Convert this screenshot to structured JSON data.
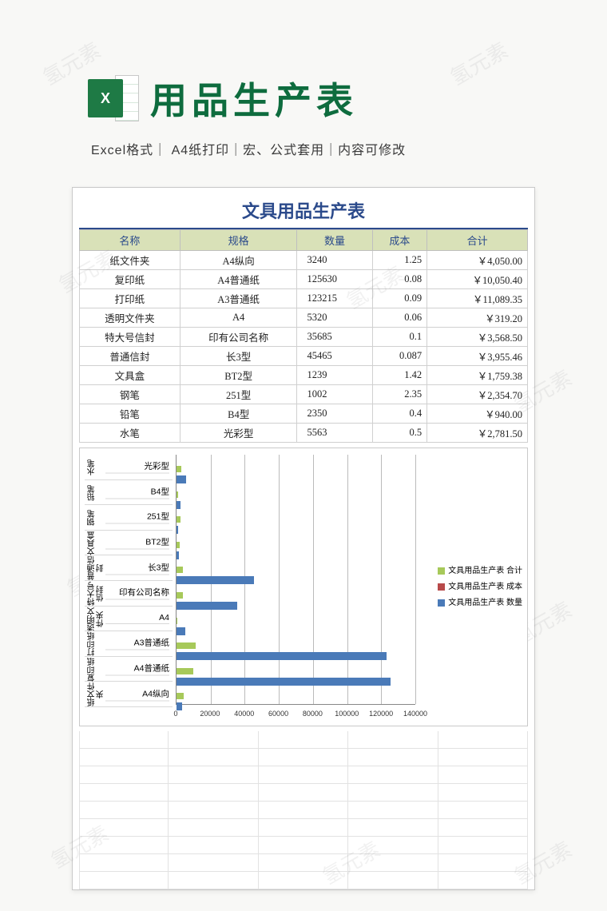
{
  "header": {
    "icon_label": "X",
    "title": "用品生产表",
    "subtitle": "Excel格式｜ A4纸打印｜宏、公式套用｜内容可修改"
  },
  "doc_title": "文具用品生产表",
  "columns": [
    "名称",
    "规格",
    "数量",
    "成本",
    "合计"
  ],
  "rows": [
    {
      "name": "纸文件夹",
      "spec": "A4纵向",
      "qty": "3240",
      "cost": "1.25",
      "total": "￥4,050.00"
    },
    {
      "name": "复印纸",
      "spec": "A4普通纸",
      "qty": "125630",
      "cost": "0.08",
      "total": "￥10,050.40"
    },
    {
      "name": "打印纸",
      "spec": "A3普通纸",
      "qty": "123215",
      "cost": "0.09",
      "total": "￥11,089.35"
    },
    {
      "name": "透明文件夹",
      "spec": "A4",
      "qty": "5320",
      "cost": "0.06",
      "total": "￥319.20"
    },
    {
      "name": "特大号信封",
      "spec": "印有公司名称",
      "qty": "35685",
      "cost": "0.1",
      "total": "￥3,568.50"
    },
    {
      "name": "普通信封",
      "spec": "长3型",
      "qty": "45465",
      "cost": "0.087",
      "total": "￥3,955.46"
    },
    {
      "name": "文具盒",
      "spec": "BT2型",
      "qty": "1239",
      "cost": "1.42",
      "total": "￥1,759.38"
    },
    {
      "name": "钢笔",
      "spec": "251型",
      "qty": "1002",
      "cost": "2.35",
      "total": "￥2,354.70"
    },
    {
      "name": "铅笔",
      "spec": "B4型",
      "qty": "2350",
      "cost": "0.4",
      "total": "￥940.00"
    },
    {
      "name": "水笔",
      "spec": "光彩型",
      "qty": "5563",
      "cost": "0.5",
      "total": "￥2,781.50"
    }
  ],
  "legend": {
    "heji": "文具用品生产表 合计",
    "cost": "文具用品生产表 成本",
    "qty": "文具用品生产表 数量"
  },
  "chart_data": {
    "type": "bar",
    "orientation": "horizontal",
    "xlabel": "",
    "ylabel": "",
    "xlim": [
      0,
      140000
    ],
    "xticks": [
      0,
      20000,
      40000,
      60000,
      80000,
      100000,
      120000,
      140000
    ],
    "categories_name": [
      "水笔",
      "铅笔",
      "钢笔",
      "文具盒",
      "普通信封",
      "特大号信封",
      "透明文件夹",
      "打印纸",
      "复印纸",
      "纸文件夹"
    ],
    "categories_spec": [
      "光彩型",
      "B4型",
      "251型",
      "BT2型",
      "长3型",
      "印有公司名称",
      "A4",
      "A3普通纸",
      "A4普通纸",
      "A4纵向"
    ],
    "series": [
      {
        "name": "文具用品生产表 合计",
        "color": "#a7c95a",
        "values": [
          2781.5,
          940,
          2354.7,
          1759.38,
          3955.46,
          3568.5,
          319.2,
          11089.35,
          10050.4,
          4050
        ]
      },
      {
        "name": "文具用品生产表 成本",
        "color": "#b84a4a",
        "values": [
          0.5,
          0.4,
          2.35,
          1.42,
          0.087,
          0.1,
          0.06,
          0.09,
          0.08,
          1.25
        ]
      },
      {
        "name": "文具用品生产表 数量",
        "color": "#4a7ab8",
        "values": [
          5563,
          2350,
          1002,
          1239,
          45465,
          35685,
          5320,
          123215,
          125630,
          3240
        ]
      }
    ]
  },
  "watermark": "氢元素"
}
